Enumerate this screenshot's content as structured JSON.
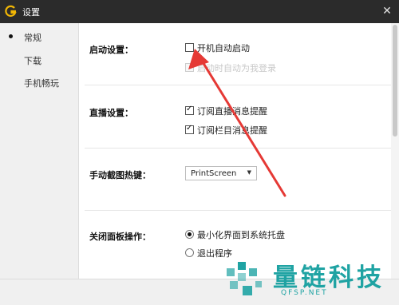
{
  "window": {
    "title": "设置",
    "close_glyph": "✕"
  },
  "sidebar": {
    "items": [
      {
        "label": "常规",
        "active": true
      },
      {
        "label": "下载",
        "active": false
      },
      {
        "label": "手机畅玩",
        "active": false
      }
    ]
  },
  "startup": {
    "label": "启动设置：",
    "options": [
      {
        "label": "开机自动启动",
        "checked": false,
        "disabled": false
      },
      {
        "label": "启动时自动为我登录",
        "checked": false,
        "disabled": true
      }
    ]
  },
  "live": {
    "label": "直播设置：",
    "options": [
      {
        "label": "订阅直播消息提醒",
        "checked": true
      },
      {
        "label": "订阅栏目消息提醒",
        "checked": true
      }
    ]
  },
  "hotkey": {
    "label": "手动截图热键：",
    "value": "PrintScreen",
    "caret": "▼"
  },
  "close_panel": {
    "label": "关闭面板操作：",
    "options": [
      {
        "label": "最小化界面到系统托盘",
        "checked": true
      },
      {
        "label": "退出程序",
        "checked": false
      }
    ]
  },
  "watermark": {
    "text": "量链科技",
    "url": "QFSP.NET"
  },
  "colors": {
    "titlebar": "#2b2b2b",
    "accent_logo": "#f2b705",
    "arrow": "#e53935",
    "watermark": "#1fa3a3"
  },
  "icons": {
    "app": "g-logo-icon",
    "close": "close-icon",
    "checkbox": "checkbox-icon",
    "radio": "radio-icon"
  }
}
